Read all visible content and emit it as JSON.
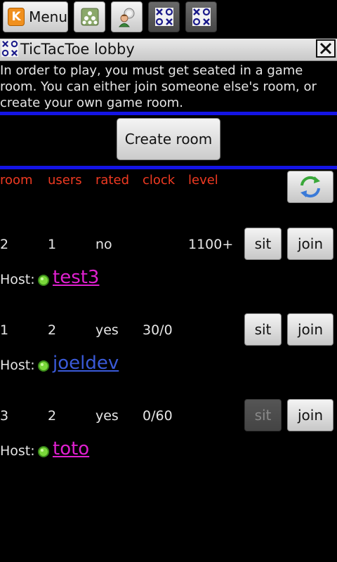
{
  "toolbar": {
    "menu_label": "Menu",
    "menu_icon": "K",
    "icons": [
      "rooms-icon",
      "players-icon",
      "tictactoe-icon",
      "tictactoe-icon"
    ]
  },
  "lobby": {
    "title": "TicTacToe lobby",
    "intro": "In order to play, you must get seated in a game room. You can either join someone else's room, or create your own game room.",
    "create_label": "Create room"
  },
  "table": {
    "headers": {
      "room": "room",
      "users": "users",
      "rated": "rated",
      "clock": "clock",
      "level": "level"
    },
    "header_color": "#ef3a22",
    "sit_label": "sit",
    "join_label": "join",
    "host_label": "Host:",
    "rooms": [
      {
        "room": "2",
        "users": "1",
        "rated": "no",
        "clock": "",
        "level": "1100+",
        "host": "test3",
        "host_color": "#e020d0",
        "sit_enabled": true
      },
      {
        "room": "1",
        "users": "2",
        "rated": "yes",
        "clock": "30/0",
        "level": "",
        "host": "joeldev",
        "host_color": "#3a5ad8",
        "sit_enabled": true
      },
      {
        "room": "3",
        "users": "2",
        "rated": "yes",
        "clock": "0/60",
        "level": "",
        "host": "toto",
        "host_color": "#e020d0",
        "sit_enabled": false
      }
    ]
  },
  "colors": {
    "divider": "#1414e6",
    "background": "#000000"
  }
}
